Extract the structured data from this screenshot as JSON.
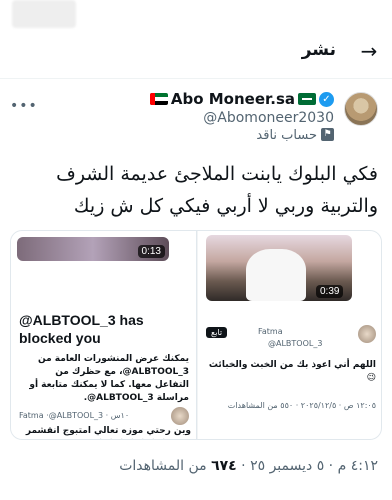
{
  "header": {
    "back_glyph": "→",
    "title": "نشر"
  },
  "author": {
    "display_name": "Abo Moneer.sa",
    "handle": "@Abomoneer2030",
    "label": "حساب ناقد"
  },
  "tweet": {
    "text": "فكي البلوك يابنت الملاجئ عديمة الشرف والتربية وربي لا أربي فيكي كل ش زيك"
  },
  "media": {
    "left": {
      "video_duration": "0:13",
      "blocked_title": "@ALBTOOL_3 has blocked you",
      "blocked_body": "يمكنك عرض المنشورات العامة من ALBTOOL_3@، مع حظرك من التفاعل معها. كما لا يمكنك متابعة أو مراسلة ALBTOOL_3@.",
      "quote_header": "Fatma ·@ALBTOOL_3 · ١٠س",
      "quote_text": "وين رحتي موزه تعالي امتبوج انقشمر وياج 😂😂😂😂😂😂😂"
    },
    "right": {
      "video_duration": "0:39",
      "tag": "تابع",
      "quote_name": "Fatma",
      "quote_handle": "@ALBTOOL_3",
      "quote_text": "اللهم أني اعوذ بك من الخبث والخبائث 😉",
      "quote_meta": "١٢:٠٥ ص · ٢٠٢٥/١٢/٥ · ٥٥٠ من المشاهدات"
    }
  },
  "meta": {
    "time": "٤:١٢ م",
    "date": "٥ ديسمبر ٢٥",
    "views_count": "٦٧٤",
    "views_label": "من المشاهدات"
  },
  "colors": {
    "accent": "#1d9bf0",
    "muted": "#536471",
    "text": "#0f1419"
  }
}
